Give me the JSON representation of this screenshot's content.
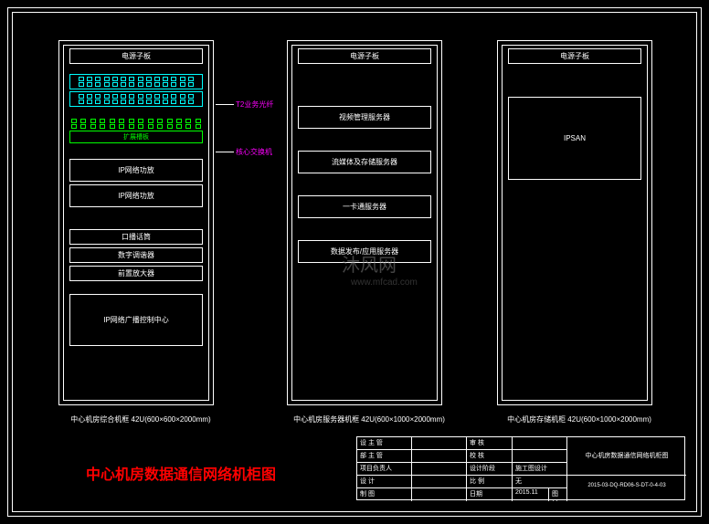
{
  "cabinet1": {
    "header": "电源子板",
    "units": [
      "扩展槽板",
      "IP网络功放",
      "IP网络功放",
      "口播话筒",
      "数字调谐器",
      "前置放大器",
      "IP网络广播控制中心"
    ],
    "caption": "中心机房综合机框 42U(600×600×2000mm)"
  },
  "cabinet2": {
    "header": "电源子板",
    "units": [
      "视频管理服务器",
      "流媒体及存储服务器",
      "一卡通服务器",
      "数据发布/应用服务器"
    ],
    "caption": "中心机房服务器机框 42U(600×1000×2000mm)"
  },
  "cabinet3": {
    "header": "电源子板",
    "main": "IPSAN",
    "caption": "中心机房存储机柜 42U(600×1000×2000mm)"
  },
  "annotations": {
    "a1": "T2业务光纤",
    "a2": "核心交换机"
  },
  "title": "中心机房数据通信网络机柜图",
  "titleblock": {
    "r1c1": "设 主 管",
    "r1c2": "审 核",
    "r2c1": "部 主 管",
    "r2c2": "校 核",
    "r3c1": "项目负责人",
    "r3c2": "设计阶段",
    "r3c3": "施工图设计",
    "r4c1": "设 计",
    "r4c2": "比 例",
    "r4c3": "无",
    "r5c1": "制 图",
    "r5c2": "日期",
    "r5c3": "2015.11",
    "r5c4": "图号",
    "name": "中心机房数据通信网络机柜图",
    "code": "2015-03-DQ-RD06-S-DT-0-4-03"
  },
  "watermark": "沐风网",
  "wm_url": "www.mfcad.com"
}
